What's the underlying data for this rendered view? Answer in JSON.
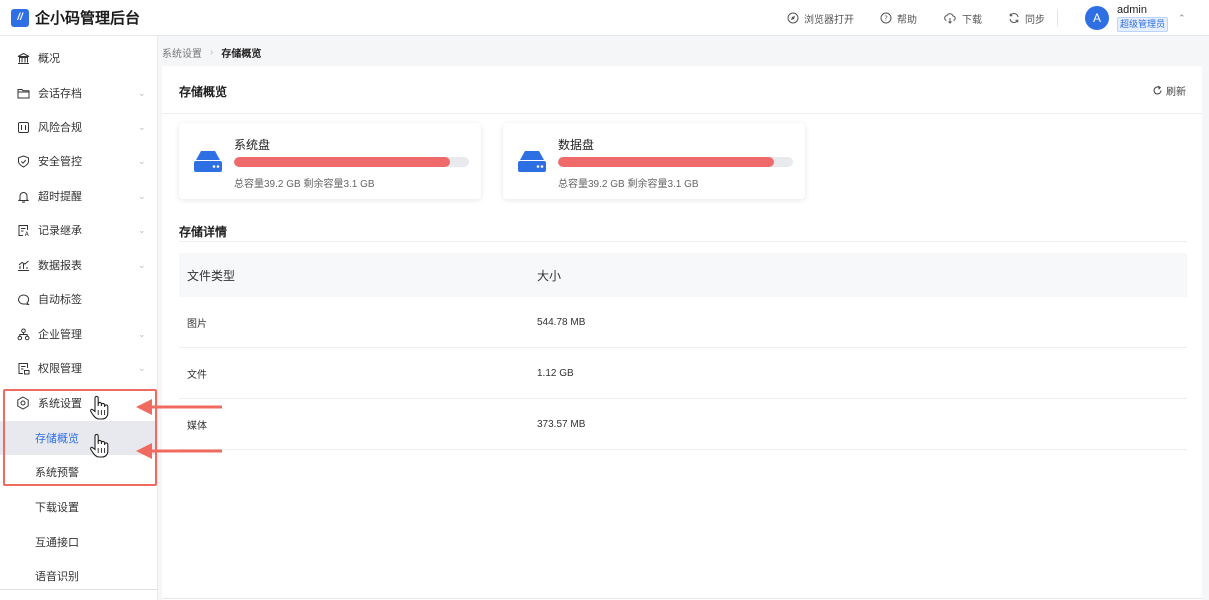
{
  "app": {
    "title": "企小码管理后台",
    "logo_text": "//"
  },
  "topbar": {
    "actions": [
      {
        "label": "浏览器打开",
        "icon": "compass-icon"
      },
      {
        "label": "帮助",
        "icon": "help-icon"
      },
      {
        "label": "下载",
        "icon": "cloud-download-icon"
      },
      {
        "label": "同步",
        "icon": "sync-icon"
      }
    ],
    "user": {
      "avatar_letter": "A",
      "name": "admin",
      "role": "超级管理员"
    }
  },
  "sidebar": {
    "items": [
      {
        "label": "概况",
        "icon": "bank-icon",
        "expandable": false
      },
      {
        "label": "会话存档",
        "icon": "folder-icon",
        "expandable": true
      },
      {
        "label": "风险合规",
        "icon": "book-icon",
        "expandable": true
      },
      {
        "label": "安全管控",
        "icon": "shield-check-icon",
        "expandable": true
      },
      {
        "label": "超时提醒",
        "icon": "bell-icon",
        "expandable": true
      },
      {
        "label": "记录继承",
        "icon": "record-icon",
        "expandable": true
      },
      {
        "label": "数据报表",
        "icon": "chart-icon",
        "expandable": true
      },
      {
        "label": "自动标签",
        "icon": "tag-chat-icon",
        "expandable": false
      },
      {
        "label": "企业管理",
        "icon": "org-icon",
        "expandable": true
      },
      {
        "label": "权限管理",
        "icon": "permission-icon",
        "expandable": true
      },
      {
        "label": "系统设置",
        "icon": "settings-icon",
        "expandable": false
      }
    ],
    "sub_items": [
      {
        "label": "存储概览",
        "active": true
      },
      {
        "label": "系统预警",
        "active": false
      },
      {
        "label": "下载设置",
        "active": false
      },
      {
        "label": "互通接口",
        "active": false
      },
      {
        "label": "语音识别",
        "active": false
      }
    ]
  },
  "breadcrumb": {
    "parent": "系统设置",
    "current": "存储概览"
  },
  "panel": {
    "title": "存储概览",
    "refresh_label": "刷新",
    "disks": [
      {
        "name": "系统盘",
        "used_fraction": 0.92,
        "capacity_text": "总容量39.2 GB 剩余容量3.1 GB"
      },
      {
        "name": "数据盘",
        "used_fraction": 0.92,
        "capacity_text": "总容量39.2 GB 剩余容量3.1 GB"
      }
    ],
    "details_title": "存储详情",
    "table": {
      "headers": [
        "文件类型",
        "大小"
      ],
      "rows": [
        [
          "图片",
          "544.78 MB"
        ],
        [
          "文件",
          "1.12 GB"
        ],
        [
          "媒体",
          "373.57 MB"
        ]
      ]
    }
  },
  "colors": {
    "accent": "#2f6fe4",
    "usage_bar": "#ef6b6b",
    "annotation": "#ef6b5f"
  }
}
